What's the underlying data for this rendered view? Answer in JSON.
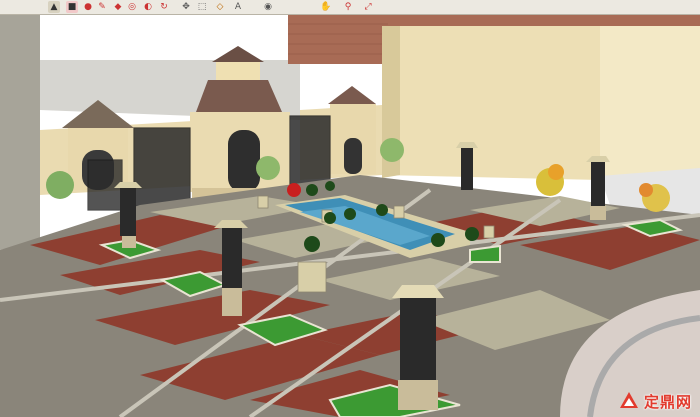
{
  "toolbar": {
    "icons": [
      "select-icon",
      "eraser-icon",
      "paint-icon",
      "pencil-icon",
      "rectangle-icon",
      "circle-icon",
      "push-pull-icon",
      "move-icon",
      "rotate-icon",
      "scale-icon",
      "tape-icon",
      "text-icon",
      "orbit-icon",
      "pan-icon",
      "zoom-icon",
      "zoom-extents-icon"
    ]
  },
  "watermark": {
    "text": "定鼎网",
    "logo_color": "#e23b2e"
  },
  "colors": {
    "sky": "#ffffff",
    "paving_red": "#8a3b2e",
    "paving_light": "#b9b39a",
    "paving_grey": "#8f8f86",
    "building_cream": "#ece0b5",
    "brick": "#a56a52",
    "lawn": "#3c9a33",
    "water": "#3f8fb7",
    "iron": "#2a2a2a"
  }
}
